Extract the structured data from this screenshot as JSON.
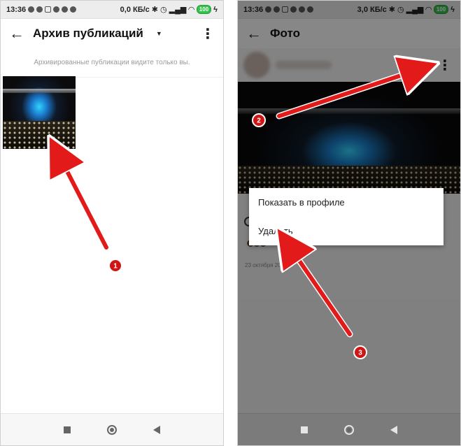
{
  "status_left": {
    "time": "13:36",
    "speed": "0,0 КБ/с",
    "battery": "100"
  },
  "status_right": {
    "time": "13:36",
    "speed": "3,0 КБ/с",
    "battery": "100"
  },
  "archive": {
    "title": "Архив публикаций",
    "hint": "Архивированные публикации видите только вы."
  },
  "photo_screen": {
    "title": "Фото",
    "date": "23 октября 20",
    "menu": [
      "Показать в профиле",
      "Удалить"
    ]
  },
  "steps": [
    "1",
    "2",
    "3"
  ],
  "colors": {
    "arrow": "#e31a1a",
    "menu_bg": "#ffffff",
    "dim": "#000000"
  }
}
